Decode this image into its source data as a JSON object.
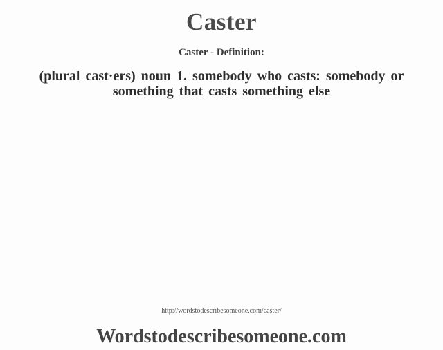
{
  "word": "Caster",
  "subtitle": "Caster -  Definition:",
  "definition": {
    "lines": [
      "(plural cast·ers) noun  1. somebody  who casts: somebody  or",
      "something  that casts something  else"
    ]
  },
  "source_url": "http://wordstodescribesomeone.com/caster/",
  "brand": "Wordstodescribesomeone.com",
  "colors": {
    "background": "#fdfdfd",
    "title": "#4a4a4a",
    "text": "#2e2e2e"
  }
}
